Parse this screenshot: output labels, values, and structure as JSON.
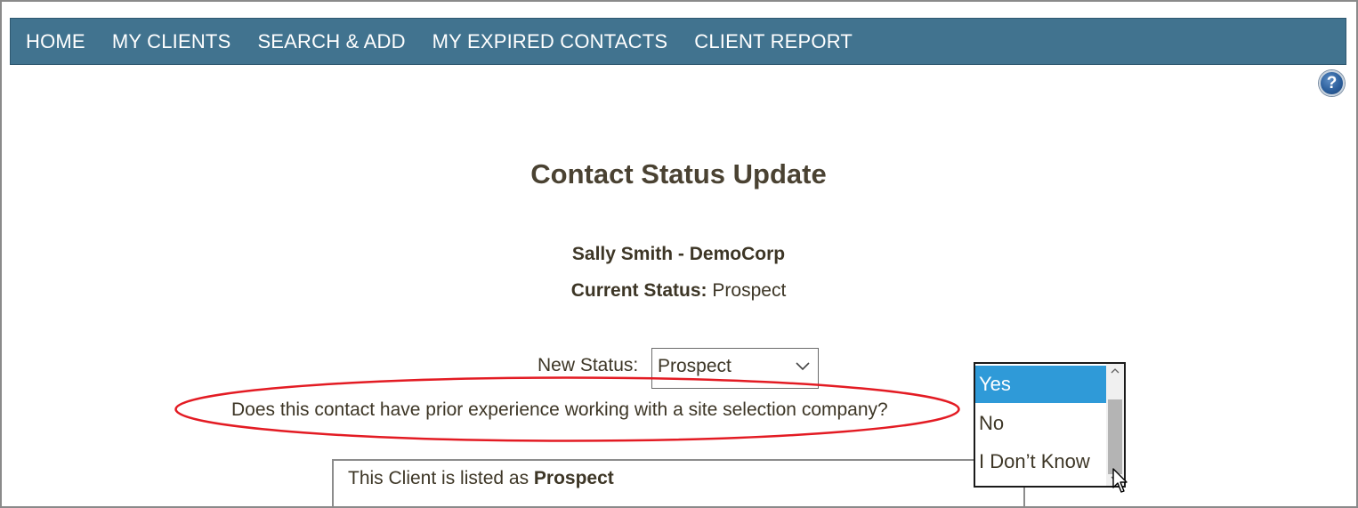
{
  "nav": {
    "items": [
      {
        "label": "HOME"
      },
      {
        "label": "MY CLIENTS"
      },
      {
        "label": "SEARCH & ADD"
      },
      {
        "label": "MY EXPIRED CONTACTS"
      },
      {
        "label": "CLIENT REPORT"
      }
    ],
    "bar_color": "#41738f"
  },
  "help": {
    "glyph": "?"
  },
  "page": {
    "title": "Contact Status Update",
    "client": "Sally Smith - DemoCorp",
    "current_status_label": "Current Status:",
    "current_status_value": "Prospect"
  },
  "form": {
    "new_status_label": "New Status:",
    "new_status_value": "Prospect",
    "question": "Does this contact have prior experience working with a site selection company?"
  },
  "dropdown": {
    "options": [
      {
        "label": "Yes",
        "selected": true
      },
      {
        "label": "No",
        "selected": false
      },
      {
        "label": "I Don’t Know",
        "selected": false
      }
    ],
    "selected_color": "#2f9ad8"
  },
  "info_box": {
    "prefix": "This Client is listed as",
    "status": "Prospect"
  },
  "annotation": {
    "color": "#e31b23"
  }
}
